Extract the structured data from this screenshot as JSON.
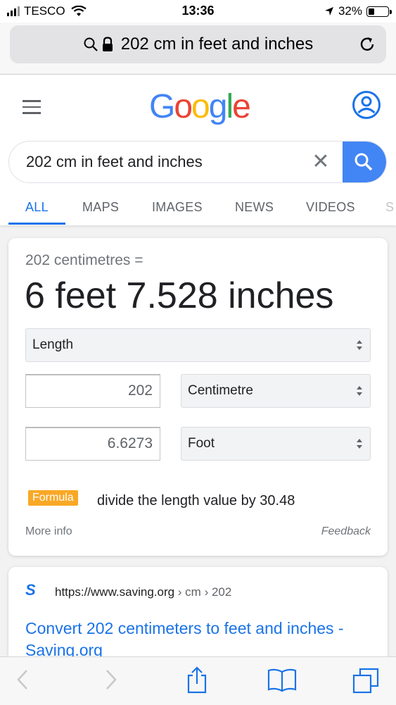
{
  "status_bar": {
    "carrier": "TESCO",
    "time": "13:36",
    "battery": "32%",
    "battery_level": 0.32
  },
  "address_bar": {
    "query": "202 cm in feet and inches"
  },
  "google": {
    "logo": [
      "G",
      "o",
      "o",
      "g",
      "l",
      "e"
    ],
    "search_value": "202 cm in feet and inches",
    "tabs": [
      "ALL",
      "MAPS",
      "IMAGES",
      "NEWS",
      "VIDEOS",
      "S"
    ],
    "active_tab": "ALL"
  },
  "converter": {
    "subtitle": "202 centimetres =",
    "result": "6 feet 7.528 inches",
    "quantity": "Length",
    "input_value": "202",
    "input_unit": "Centimetre",
    "output_value": "6.6273",
    "output_unit": "Foot",
    "formula_badge": "Formula",
    "formula_text": "divide the length value by 30.48",
    "more_info": "More info",
    "feedback": "Feedback"
  },
  "result": {
    "favicon": "S",
    "url_base": "https://www.saving.org",
    "url_crumbs": " › cm › 202",
    "title": "Convert 202 centimeters to feet and inches - Saving.org"
  },
  "colors": {
    "google_blue": "#4285f4",
    "link_blue": "#1a73e8",
    "formula_orange": "#f9a825"
  },
  "icons": {
    "status": [
      "signal-icon",
      "wifi-icon",
      "location-arrow-icon",
      "battery-icon"
    ],
    "address": [
      "search-icon",
      "lock-icon",
      "reload-icon"
    ],
    "toolbar": [
      "back-icon",
      "forward-icon",
      "share-icon",
      "bookmarks-icon",
      "tabs-icon"
    ]
  }
}
